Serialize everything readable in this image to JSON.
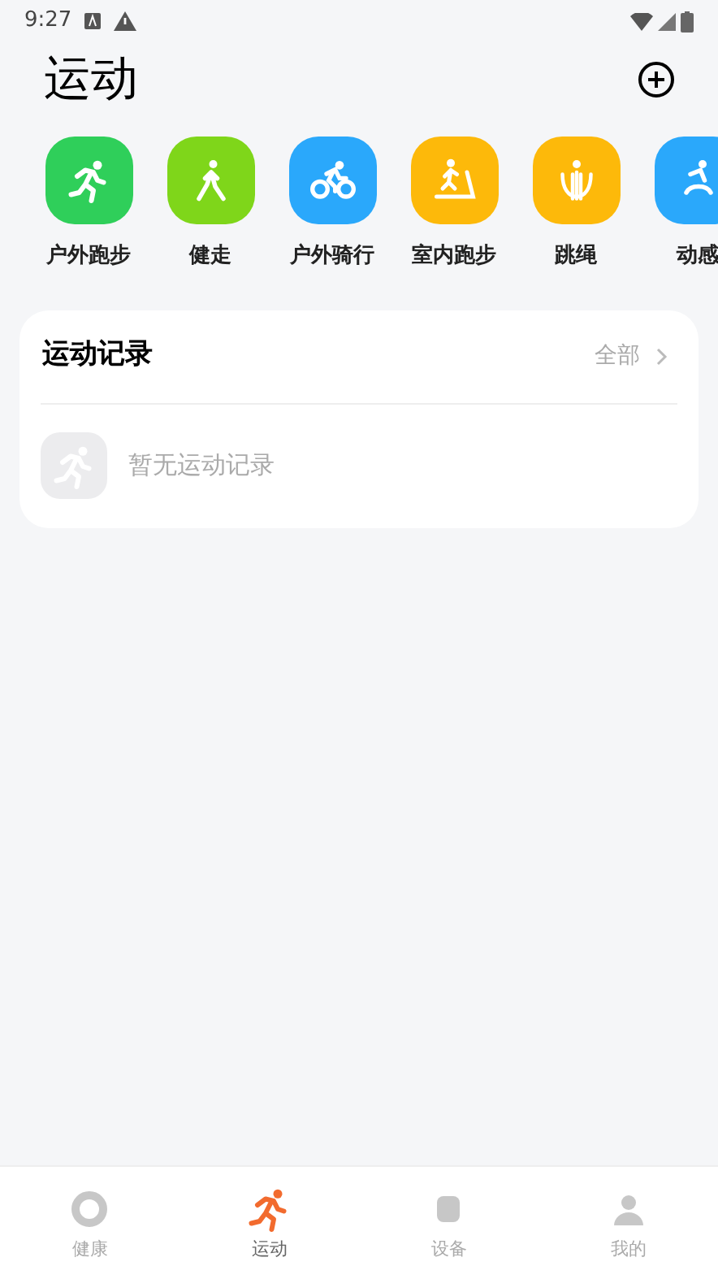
{
  "status_bar": {
    "time": "9:27"
  },
  "header": {
    "title": "运动"
  },
  "sports": [
    {
      "label": "户外跑步",
      "color": "#2fcf5a"
    },
    {
      "label": "健走",
      "color": "#7fd61a"
    },
    {
      "label": "户外骑行",
      "color": "#2aa8fb"
    },
    {
      "label": "室内跑步",
      "color": "#fdb90a"
    },
    {
      "label": "跳绳",
      "color": "#fdb90a"
    },
    {
      "label": "动感",
      "color": "#2aa8fb"
    }
  ],
  "records": {
    "title": "运动记录",
    "link": "全部",
    "empty": "暂无运动记录"
  },
  "tab_bar": [
    {
      "label": "健康",
      "selected": false
    },
    {
      "label": "运动",
      "selected": true
    },
    {
      "label": "设备",
      "selected": false
    },
    {
      "label": "我的",
      "selected": false
    }
  ]
}
